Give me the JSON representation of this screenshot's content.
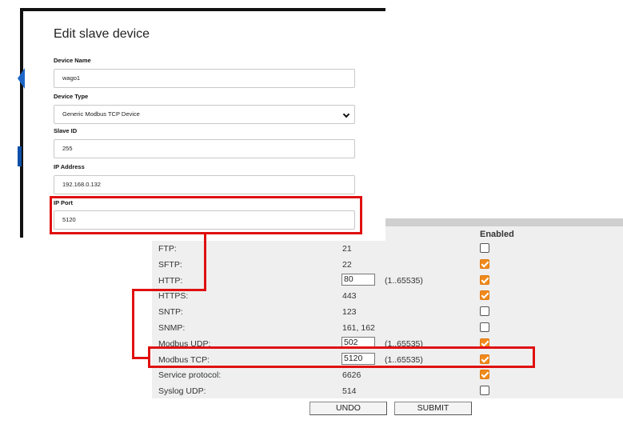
{
  "dialog": {
    "title": "Edit slave device",
    "fields": {
      "device_name": {
        "label": "Device Name",
        "value": "wago1"
      },
      "device_type": {
        "label": "Device Type",
        "value": "Generic Modbus TCP Device"
      },
      "slave_id": {
        "label": "Slave ID",
        "value": "255"
      },
      "ip_address": {
        "label": "IP Address",
        "value": "192.168.0.132"
      },
      "ip_port": {
        "label": "IP Port",
        "value": "5120"
      }
    }
  },
  "services": {
    "enabled_header": "Enabled",
    "rows": [
      {
        "name": "FTP:",
        "value": "21",
        "editable": false,
        "range": "",
        "enabled": false
      },
      {
        "name": "SFTP:",
        "value": "22",
        "editable": false,
        "range": "",
        "enabled": true
      },
      {
        "name": "HTTP:",
        "value": "80",
        "editable": true,
        "range": "(1..65535)",
        "enabled": true
      },
      {
        "name": "HTTPS:",
        "value": "443",
        "editable": false,
        "range": "",
        "enabled": true
      },
      {
        "name": "SNTP:",
        "value": "123",
        "editable": false,
        "range": "",
        "enabled": false
      },
      {
        "name": "SNMP:",
        "value": "161, 162",
        "editable": false,
        "range": "",
        "enabled": false
      },
      {
        "name": "Modbus UDP:",
        "value": "502",
        "editable": true,
        "range": "(1..65535)",
        "enabled": true
      },
      {
        "name": "Modbus TCP:",
        "value": "5120",
        "editable": true,
        "range": "(1..65535)",
        "enabled": true
      },
      {
        "name": "Service protocol:",
        "value": "6626",
        "editable": false,
        "range": "",
        "enabled": true
      },
      {
        "name": "Syslog UDP:",
        "value": "514",
        "editable": false,
        "range": "",
        "enabled": false
      }
    ],
    "undo_label": "UNDO",
    "submit_label": "SUBMIT"
  },
  "colors": {
    "annotation": "#e01010",
    "checkbox_checked": "#f08a1c",
    "panel_bg": "#efefef",
    "accent_blue": "#1e66c8"
  }
}
